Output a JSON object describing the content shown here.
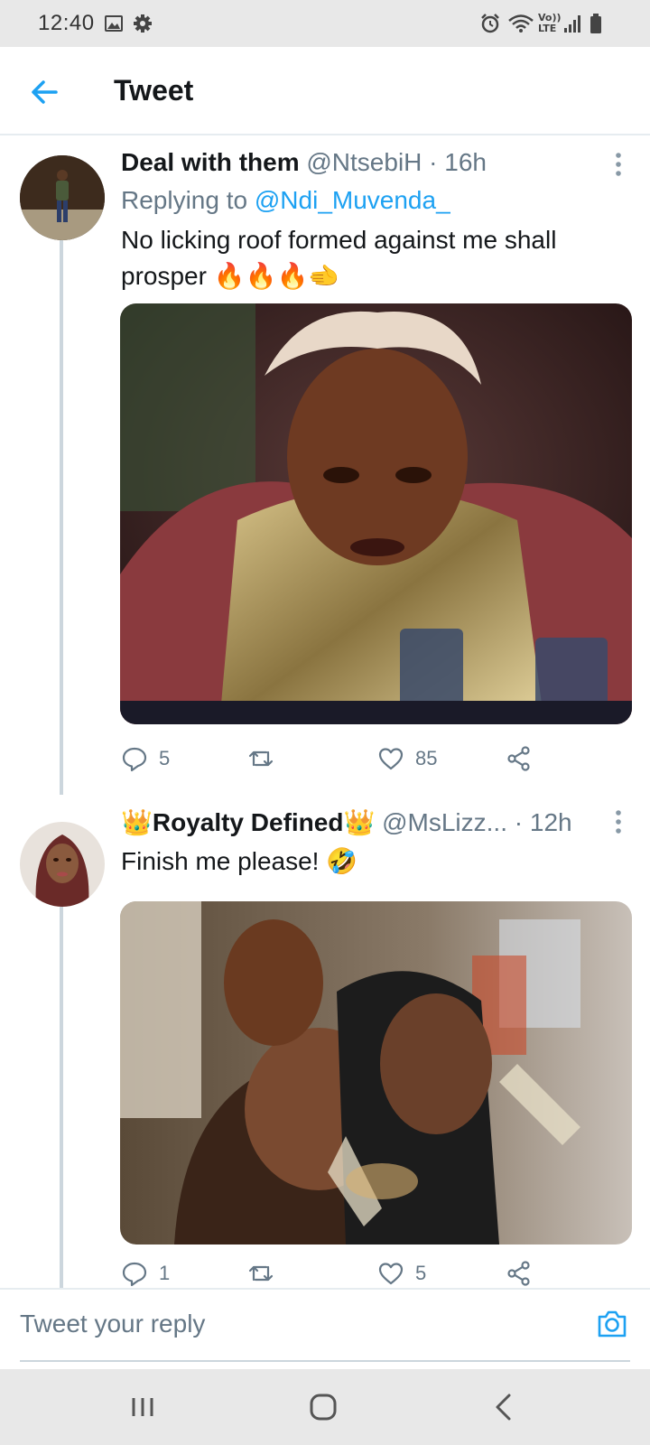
{
  "status_bar": {
    "time": "12:40",
    "icons": [
      "image-icon",
      "gear-icon",
      "alarm-icon",
      "wifi-icon",
      "volte-icon",
      "signal-icon",
      "battery-icon"
    ],
    "volte_text": "Vo)) LTE"
  },
  "header": {
    "title": "Tweet",
    "back_icon": "arrow-left-icon",
    "accent": "#1da1f2"
  },
  "tweets": [
    {
      "author": "Deal with them",
      "handle": "@NtsebiH",
      "dot": "·",
      "time": "16h",
      "replying_prefix": "Replying to ",
      "replying_to": "@Ndi_Muvenda_",
      "text": "No licking roof formed against me shall prosper 🔥🔥🔥🫲",
      "replies": "5",
      "retweets": "",
      "likes": "85"
    },
    {
      "author": "👑Royalty Defined👑",
      "handle": "@MsLizz...",
      "dot": "·",
      "time": "12h",
      "text": "Finish me please! 🤣",
      "replies": "1",
      "retweets": "",
      "likes": "5"
    }
  ],
  "composer": {
    "placeholder": "Tweet your reply"
  },
  "nav": {
    "icons": [
      "recent-apps-icon",
      "home-icon",
      "back-icon"
    ]
  },
  "colors": {
    "accent": "#1da1f2",
    "secondary_text": "#657786",
    "divider": "#e6ecf0",
    "system_bar": "#e8e8e8"
  }
}
